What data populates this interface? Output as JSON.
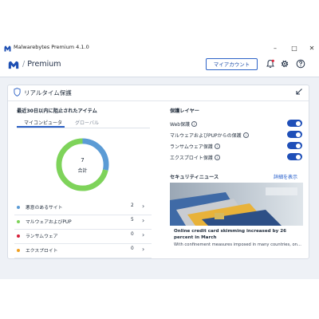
{
  "window": {
    "title": "Malwarebytes Premium 4.1.0",
    "minimize_icon": "minimize-icon",
    "maximize_icon": "maximize-icon",
    "close_icon": "close-icon"
  },
  "header": {
    "app_name": "Premium",
    "separator": "/",
    "account_button": "マイアカウント",
    "icons": [
      "notification-bell-icon",
      "settings-gear-icon",
      "help-icon"
    ],
    "accent_color": "#2a5fc4"
  },
  "realtime_card": {
    "title": "リアルタイム保護",
    "collapse_icon": "collapse-arrow-icon"
  },
  "quarantine": {
    "title": "最近30日以内に阻止されたアイテム",
    "tabs": [
      {
        "label": "マイコンピュータ",
        "active": true
      },
      {
        "label": "グローバル",
        "active": false
      }
    ],
    "total_value": "7",
    "total_label": "合計",
    "items": [
      {
        "label": "悪意のあるサイト",
        "count": "2",
        "color": "#5b9bd5"
      },
      {
        "label": "マルウェアおよびPUP",
        "count": "5",
        "color": "#7ed35a"
      },
      {
        "label": "ランサムウェア",
        "count": "0",
        "color": "#d6203a"
      },
      {
        "label": "エクスプロイト",
        "count": "0",
        "color": "#f0a020"
      }
    ]
  },
  "protection_layers": {
    "title": "保護レイヤー",
    "items": [
      {
        "label": "Web保護",
        "info": "i",
        "enabled": true
      },
      {
        "label": "マルウェアおよびPUPからの保護",
        "info": "i",
        "enabled": true
      },
      {
        "label": "ランサムウェア保護",
        "info": "i",
        "enabled": true
      },
      {
        "label": "エクスプロイト保護",
        "info": "i",
        "enabled": true
      }
    ]
  },
  "security_news": {
    "title": "セキュリティニュース",
    "more_link": "詳細を表示",
    "headline": "Online credit card skimming increased by 26 percent in March",
    "snippet": "With confinement measures imposed in many countries, on..."
  }
}
